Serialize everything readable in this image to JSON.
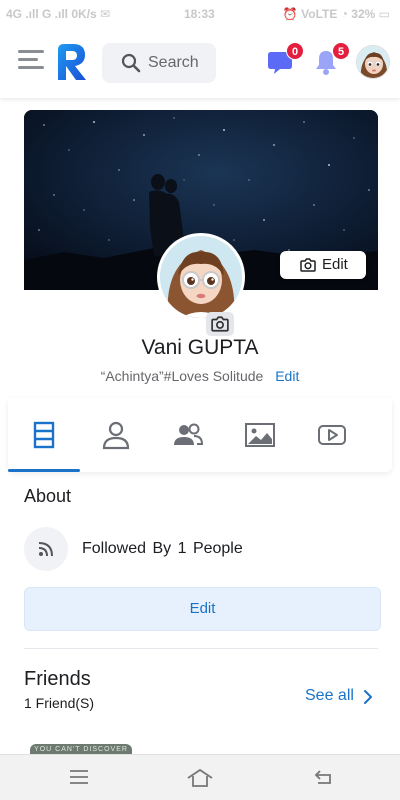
{
  "status_bar": {
    "left": "4G .ıll G .ıll 0K/s ✉",
    "time": "18:33",
    "right": "⏰ VoLTE ◔ 32% ▭"
  },
  "header": {
    "search_placeholder": "Search",
    "messages_badge": "0",
    "notifications_badge": "5"
  },
  "cover": {
    "edit_label": "Edit"
  },
  "profile": {
    "name": "Vani GUPTA",
    "bio": "“Achintya”#Loves Solitude",
    "bio_edit_label": "Edit"
  },
  "tabs": [
    {
      "name": "timeline",
      "icon": "timeline-icon",
      "active": true
    },
    {
      "name": "about",
      "icon": "person-icon",
      "active": false
    },
    {
      "name": "friends",
      "icon": "people-icon",
      "active": false
    },
    {
      "name": "photos",
      "icon": "image-icon",
      "active": false
    },
    {
      "name": "videos",
      "icon": "video-icon",
      "active": false
    }
  ],
  "about": {
    "title": "About",
    "followed_text": "Followed By  1  People",
    "edit_label": "Edit"
  },
  "friends": {
    "title": "Friends",
    "count_text": "1 Friend(S)",
    "see_all_label": "See all",
    "thumb_text": "YOU CAN'T DISCOVER"
  },
  "colors": {
    "accent": "#1a73c8",
    "badge": "#e41e3f",
    "messenger": "#5b6bf5",
    "bell": "#9aa5f7"
  }
}
